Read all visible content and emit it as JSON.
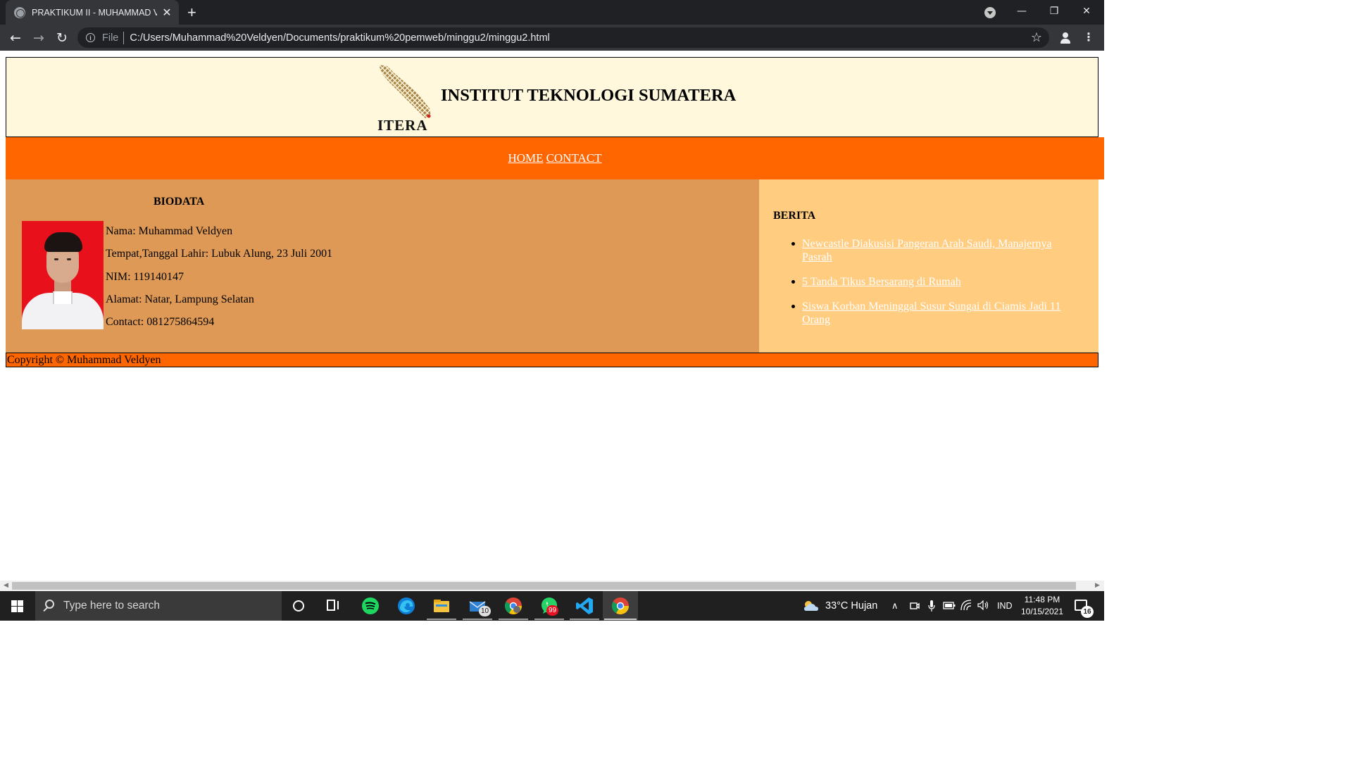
{
  "browser": {
    "tab_title": "PRAKTIKUM II - MUHAMMAD VELDYEN",
    "tab_close": "✕",
    "new_tab": "+",
    "window_controls": {
      "minimize": "—",
      "restore": "❐",
      "close": "✕"
    },
    "nav": {
      "back": "←",
      "forward": "→",
      "reload": "↻"
    },
    "address": {
      "scheme_label": "File",
      "info_icon": "i",
      "url": "C:/Users/Muhammad%20Veldyen/Documents/praktikum%20pemweb/minggu2/minggu2.html"
    },
    "bookmark_star": "☆",
    "menu": "⋮"
  },
  "page": {
    "header": {
      "logo_text": "ITERA",
      "title": "INSTITUT TEKNOLOGI SUMATERA"
    },
    "nav_links": [
      {
        "label": "HOME"
      },
      {
        "label": "CONTACT"
      }
    ],
    "biodata": {
      "title": "BIODATA",
      "lines": [
        "Nama: Muhammad Veldyen",
        "Tempat,Tanggal Lahir: Lubuk Alung, 23 Juli 2001",
        "NIM: 119140147",
        "Alamat: Natar, Lampung Selatan",
        "Contact: 081275864594"
      ]
    },
    "berita": {
      "title": "BERITA",
      "items": [
        "Newcastle Diakusisi Pangeran Arab Saudi, Manajernya Pasrah",
        "5 Tanda Tikus Bersarang di Rumah",
        "Siswa Korban Meninggal Susur Sungai di Ciamis Jadi 11 Orang"
      ]
    },
    "footer": "Copyright © Muhammad Veldyen"
  },
  "taskbar": {
    "search_placeholder": "Type here to search",
    "mail_badge": "10",
    "whatsapp_badge": "99",
    "weather": "33°C  Hujan",
    "language": "IND",
    "time": "11:48 PM",
    "date": "10/15/2021",
    "notifications": "16"
  },
  "colors": {
    "header_bg": "#fff8dc",
    "nav_bg": "#ff6600",
    "biodata_bg": "#dd9955",
    "berita_bg": "#ffcc80",
    "footer_bg": "#ff6600"
  }
}
